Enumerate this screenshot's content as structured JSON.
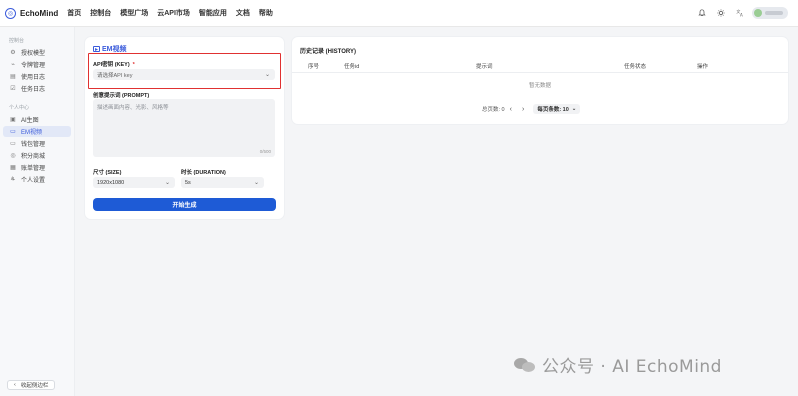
{
  "app": {
    "brand": "EchoMind",
    "nav": [
      "首页",
      "控制台",
      "模型广场",
      "云API市场",
      "智能应用",
      "文档",
      "帮助"
    ]
  },
  "topbar_icons": [
    "bell-icon",
    "sun-icon",
    "translate-icon"
  ],
  "sidebar": {
    "section1": "控制台",
    "items1": [
      {
        "label": "授权模型",
        "icon": "key-icon"
      },
      {
        "label": "令牌管理",
        "icon": "token-icon"
      },
      {
        "label": "使用日志",
        "icon": "chart-icon"
      },
      {
        "label": "任务日志",
        "icon": "task-icon"
      }
    ],
    "section2": "个人中心",
    "items2": [
      {
        "label": "AI生图",
        "icon": "image-icon"
      },
      {
        "label": "EM视频",
        "icon": "video-icon",
        "active": true
      },
      {
        "label": "钱包管理",
        "icon": "wallet-icon"
      },
      {
        "label": "积分商城",
        "icon": "gift-icon"
      },
      {
        "label": "账单管理",
        "icon": "bill-icon"
      },
      {
        "label": "个人设置",
        "icon": "user-icon"
      }
    ],
    "collapse_label": "收起侧边栏"
  },
  "form": {
    "title": "EM视频",
    "api_label": "API密钥 (KEY)",
    "api_required": "*",
    "api_placeholder": "请选择API key",
    "prompt_label": "创意提示词 (PROMPT)",
    "prompt_placeholder": "描述画面内容、光影、风格等",
    "prompt_counter": "0/500",
    "size_label": "尺寸 (SIZE)",
    "size_value": "1920x1080",
    "duration_label": "时长 (DURATION)",
    "duration_value": "5s",
    "submit_label": "开始生成"
  },
  "history": {
    "title": "历史记录 (HISTORY)",
    "columns": [
      "序号",
      "任务id",
      "提示词",
      "任务状态",
      "操作"
    ],
    "empty_text": "暂无数据",
    "total_label": "总页数: 0",
    "page_size_label": "每页条数: 10"
  },
  "watermark": "公众号 · AI EchoMind",
  "colors": {
    "primary": "#1e5bd6",
    "accent": "#3b5bdb",
    "highlight_box": "#e03131",
    "background": "#f4f5f7"
  }
}
